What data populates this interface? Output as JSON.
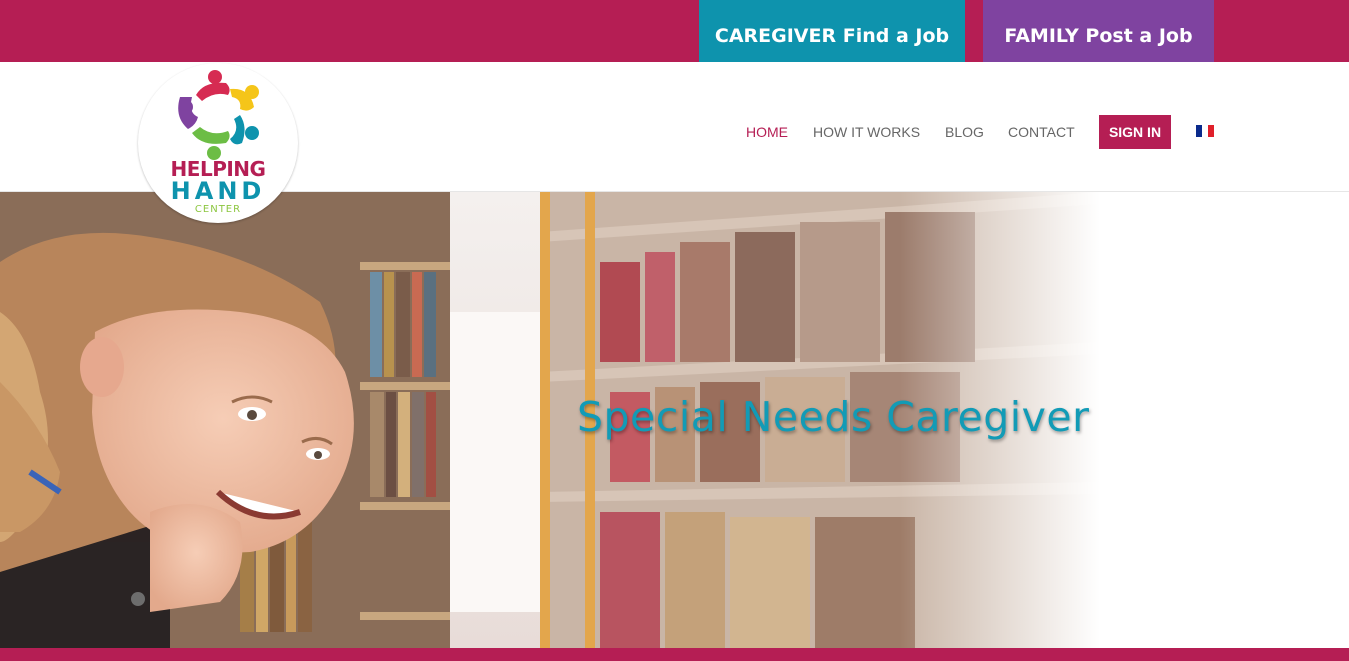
{
  "colors": {
    "brand_magenta": "#b51e54",
    "caregiver_teal": "#0e93ad",
    "family_purple": "#7f43a0",
    "hero_title": "#129bb6"
  },
  "cta": {
    "caregiver_label": "CAREGIVER Find a Job",
    "family_label": "FAMILY Post a Job"
  },
  "logo": {
    "line1": "HELPING",
    "line2": "HAND",
    "line3": "CENTER"
  },
  "nav": {
    "home": "HOME",
    "how_it_works": "HOW IT WORKS",
    "blog": "BLOG",
    "contact": "CONTACT",
    "sign_in": "SIGN IN",
    "language_icon": "french-flag-icon"
  },
  "hero": {
    "title": "Special Needs Caregiver"
  }
}
